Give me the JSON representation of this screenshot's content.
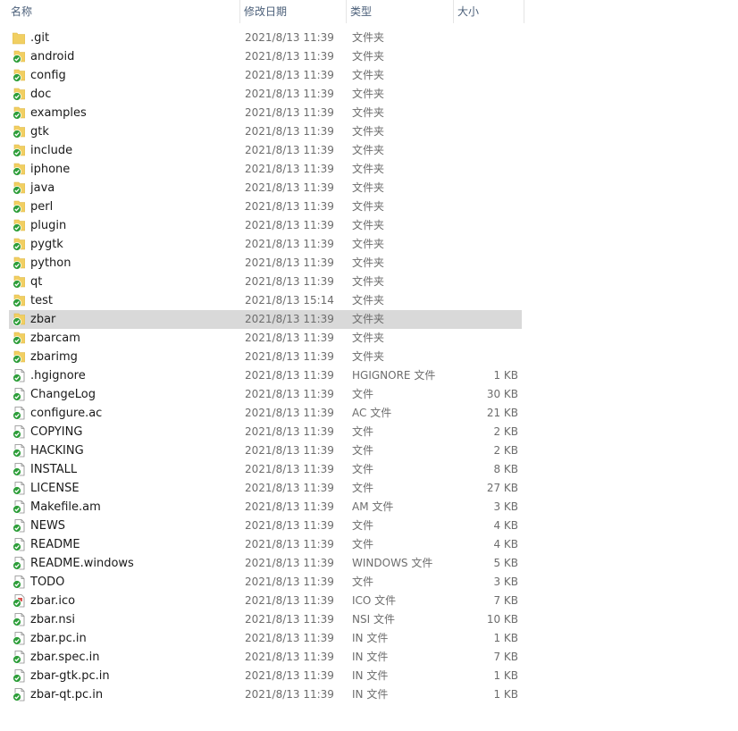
{
  "header": {
    "col_name": "名称",
    "col_date": "修改日期",
    "col_type": "类型",
    "col_size": "大小",
    "sort_indicator": "^"
  },
  "colors": {
    "folder": "#f1cf62",
    "folder_dark": "#dcb43f",
    "check_green": "#2e9e3a",
    "selected_row": "#d9d9d9",
    "header_text": "#4c607a"
  },
  "files": [
    {
      "name": ".git",
      "date": "2021/8/13 11:39",
      "type": "文件夹",
      "size": "",
      "icon": "folder-icon"
    },
    {
      "name": "android",
      "date": "2021/8/13 11:39",
      "type": "文件夹",
      "size": "",
      "icon": "folder-synced-icon"
    },
    {
      "name": "config",
      "date": "2021/8/13 11:39",
      "type": "文件夹",
      "size": "",
      "icon": "folder-synced-icon"
    },
    {
      "name": "doc",
      "date": "2021/8/13 11:39",
      "type": "文件夹",
      "size": "",
      "icon": "folder-synced-icon"
    },
    {
      "name": "examples",
      "date": "2021/8/13 11:39",
      "type": "文件夹",
      "size": "",
      "icon": "folder-synced-icon"
    },
    {
      "name": "gtk",
      "date": "2021/8/13 11:39",
      "type": "文件夹",
      "size": "",
      "icon": "folder-synced-icon"
    },
    {
      "name": "include",
      "date": "2021/8/13 11:39",
      "type": "文件夹",
      "size": "",
      "icon": "folder-synced-icon"
    },
    {
      "name": "iphone",
      "date": "2021/8/13 11:39",
      "type": "文件夹",
      "size": "",
      "icon": "folder-synced-icon"
    },
    {
      "name": "java",
      "date": "2021/8/13 11:39",
      "type": "文件夹",
      "size": "",
      "icon": "folder-synced-icon"
    },
    {
      "name": "perl",
      "date": "2021/8/13 11:39",
      "type": "文件夹",
      "size": "",
      "icon": "folder-synced-icon"
    },
    {
      "name": "plugin",
      "date": "2021/8/13 11:39",
      "type": "文件夹",
      "size": "",
      "icon": "folder-synced-icon"
    },
    {
      "name": "pygtk",
      "date": "2021/8/13 11:39",
      "type": "文件夹",
      "size": "",
      "icon": "folder-synced-icon"
    },
    {
      "name": "python",
      "date": "2021/8/13 11:39",
      "type": "文件夹",
      "size": "",
      "icon": "folder-synced-icon"
    },
    {
      "name": "qt",
      "date": "2021/8/13 11:39",
      "type": "文件夹",
      "size": "",
      "icon": "folder-synced-icon"
    },
    {
      "name": "test",
      "date": "2021/8/13 15:14",
      "type": "文件夹",
      "size": "",
      "icon": "folder-synced-icon"
    },
    {
      "name": "zbar",
      "date": "2021/8/13 11:39",
      "type": "文件夹",
      "size": "",
      "icon": "folder-synced-icon",
      "selected": true
    },
    {
      "name": "zbarcam",
      "date": "2021/8/13 11:39",
      "type": "文件夹",
      "size": "",
      "icon": "folder-synced-icon"
    },
    {
      "name": "zbarimg",
      "date": "2021/8/13 11:39",
      "type": "文件夹",
      "size": "",
      "icon": "folder-synced-icon"
    },
    {
      "name": ".hgignore",
      "date": "2021/8/13 11:39",
      "type": "HGIGNORE 文件",
      "size": "1 KB",
      "icon": "file-synced-icon"
    },
    {
      "name": "ChangeLog",
      "date": "2021/8/13 11:39",
      "type": "文件",
      "size": "30 KB",
      "icon": "file-synced-icon"
    },
    {
      "name": "configure.ac",
      "date": "2021/8/13 11:39",
      "type": "AC 文件",
      "size": "21 KB",
      "icon": "file-synced-icon"
    },
    {
      "name": "COPYING",
      "date": "2021/8/13 11:39",
      "type": "文件",
      "size": "2 KB",
      "icon": "file-synced-icon"
    },
    {
      "name": "HACKING",
      "date": "2021/8/13 11:39",
      "type": "文件",
      "size": "2 KB",
      "icon": "file-synced-icon"
    },
    {
      "name": "INSTALL",
      "date": "2021/8/13 11:39",
      "type": "文件",
      "size": "8 KB",
      "icon": "file-synced-icon"
    },
    {
      "name": "LICENSE",
      "date": "2021/8/13 11:39",
      "type": "文件",
      "size": "27 KB",
      "icon": "file-synced-icon"
    },
    {
      "name": "Makefile.am",
      "date": "2021/8/13 11:39",
      "type": "AM 文件",
      "size": "3 KB",
      "icon": "file-synced-icon"
    },
    {
      "name": "NEWS",
      "date": "2021/8/13 11:39",
      "type": "文件",
      "size": "4 KB",
      "icon": "file-synced-icon"
    },
    {
      "name": "README",
      "date": "2021/8/13 11:39",
      "type": "文件",
      "size": "4 KB",
      "icon": "file-synced-icon"
    },
    {
      "name": "README.windows",
      "date": "2021/8/13 11:39",
      "type": "WINDOWS 文件",
      "size": "5 KB",
      "icon": "file-synced-icon"
    },
    {
      "name": "TODO",
      "date": "2021/8/13 11:39",
      "type": "文件",
      "size": "3 KB",
      "icon": "file-synced-icon"
    },
    {
      "name": "zbar.ico",
      "date": "2021/8/13 11:39",
      "type": "ICO 文件",
      "size": "7 KB",
      "icon": "image-synced-icon"
    },
    {
      "name": "zbar.nsi",
      "date": "2021/8/13 11:39",
      "type": "NSI 文件",
      "size": "10 KB",
      "icon": "file-synced-icon"
    },
    {
      "name": "zbar.pc.in",
      "date": "2021/8/13 11:39",
      "type": "IN 文件",
      "size": "1 KB",
      "icon": "file-synced-icon"
    },
    {
      "name": "zbar.spec.in",
      "date": "2021/8/13 11:39",
      "type": "IN 文件",
      "size": "7 KB",
      "icon": "file-synced-icon"
    },
    {
      "name": "zbar-gtk.pc.in",
      "date": "2021/8/13 11:39",
      "type": "IN 文件",
      "size": "1 KB",
      "icon": "file-synced-icon"
    },
    {
      "name": "zbar-qt.pc.in",
      "date": "2021/8/13 11:39",
      "type": "IN 文件",
      "size": "1 KB",
      "icon": "file-synced-icon"
    }
  ]
}
